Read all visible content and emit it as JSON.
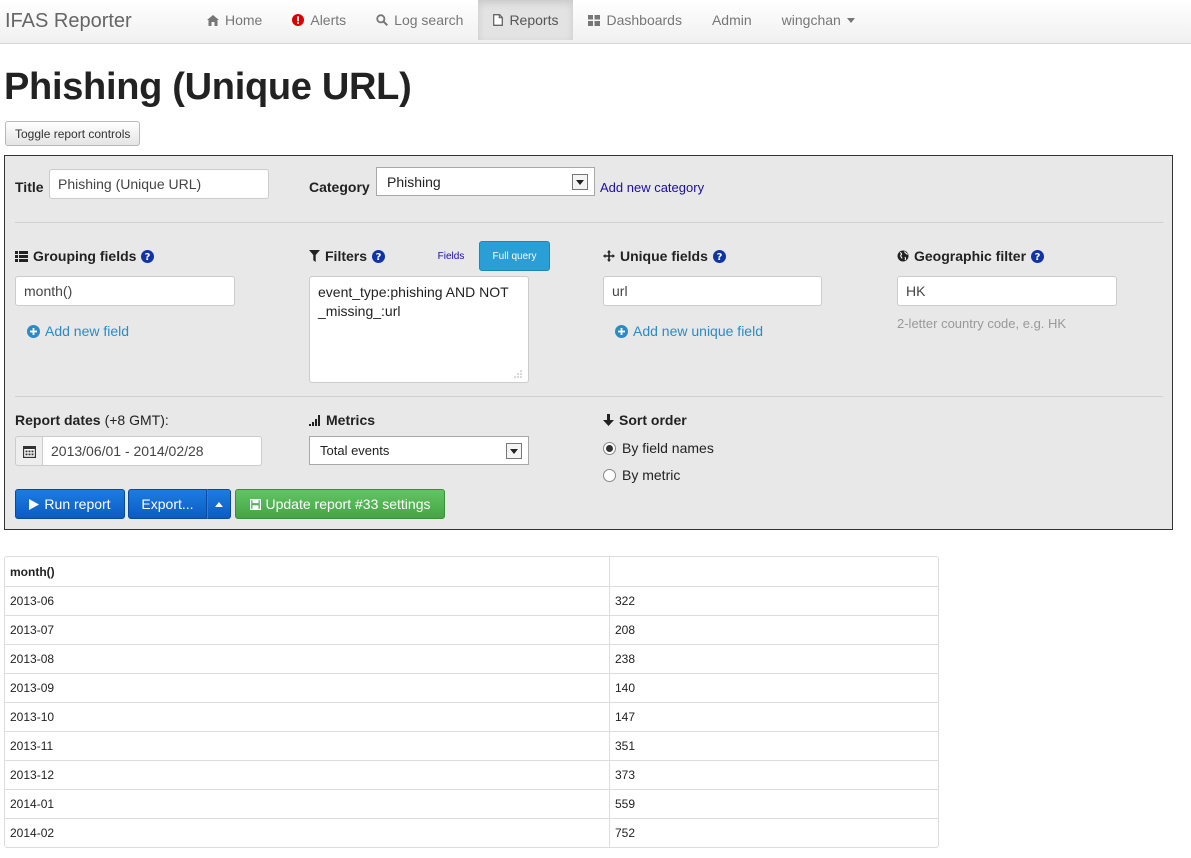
{
  "app": {
    "brand": "IFAS Reporter"
  },
  "nav": {
    "items": [
      {
        "label": "Home",
        "icon": "home-icon"
      },
      {
        "label": "Alerts",
        "icon": "alert-icon"
      },
      {
        "label": "Log search",
        "icon": "search-icon"
      },
      {
        "label": "Reports",
        "icon": "file-icon",
        "active": true
      },
      {
        "label": "Dashboards",
        "icon": "dashboard-icon"
      },
      {
        "label": "Admin"
      },
      {
        "label": "wingchan",
        "dropdown": true
      }
    ]
  },
  "page": {
    "title": "Phishing (Unique URL)",
    "toggle_label": "Toggle report controls"
  },
  "controls": {
    "title_label": "Title",
    "title_value": "Phishing (Unique URL)",
    "category_label": "Category",
    "category_value": "Phishing",
    "add_category_label": "Add new category",
    "grouping_label": "Grouping fields",
    "grouping_value": "month()",
    "add_field_label": "Add new field",
    "filters_label": "Filters",
    "filters_tab_fields": "Fields",
    "filters_tab_full": "Full query",
    "filters_query": "event_type:phishing AND NOT _missing_:url",
    "unique_label": "Unique fields",
    "unique_value": "url",
    "add_unique_label": "Add new unique field",
    "geo_label": "Geographic filter",
    "geo_value": "HK",
    "geo_hint": "2-letter country code, e.g. HK",
    "dates_label": "Report dates",
    "dates_tz": "(+8 GMT):",
    "dates_value": "2013/06/01 - 2014/02/28",
    "metrics_label": "Metrics",
    "metrics_value": "Total events",
    "sort_label": "Sort order",
    "sort_options": [
      {
        "label": "By field names",
        "selected": true
      },
      {
        "label": "By metric",
        "selected": false
      }
    ],
    "run_label": "Run report",
    "export_label": "Export...",
    "update_label": "Update report #33 settings"
  },
  "colors": {
    "primary": "#0c5bc4",
    "success": "#46a546",
    "help": "#1034a6",
    "link": "#2a8bc9"
  },
  "table": {
    "headers": [
      "month()",
      ""
    ],
    "rows": [
      [
        "2013-06",
        "322"
      ],
      [
        "2013-07",
        "208"
      ],
      [
        "2013-08",
        "238"
      ],
      [
        "2013-09",
        "140"
      ],
      [
        "2013-10",
        "147"
      ],
      [
        "2013-11",
        "351"
      ],
      [
        "2013-12",
        "373"
      ],
      [
        "2014-01",
        "559"
      ],
      [
        "2014-02",
        "752"
      ]
    ]
  }
}
